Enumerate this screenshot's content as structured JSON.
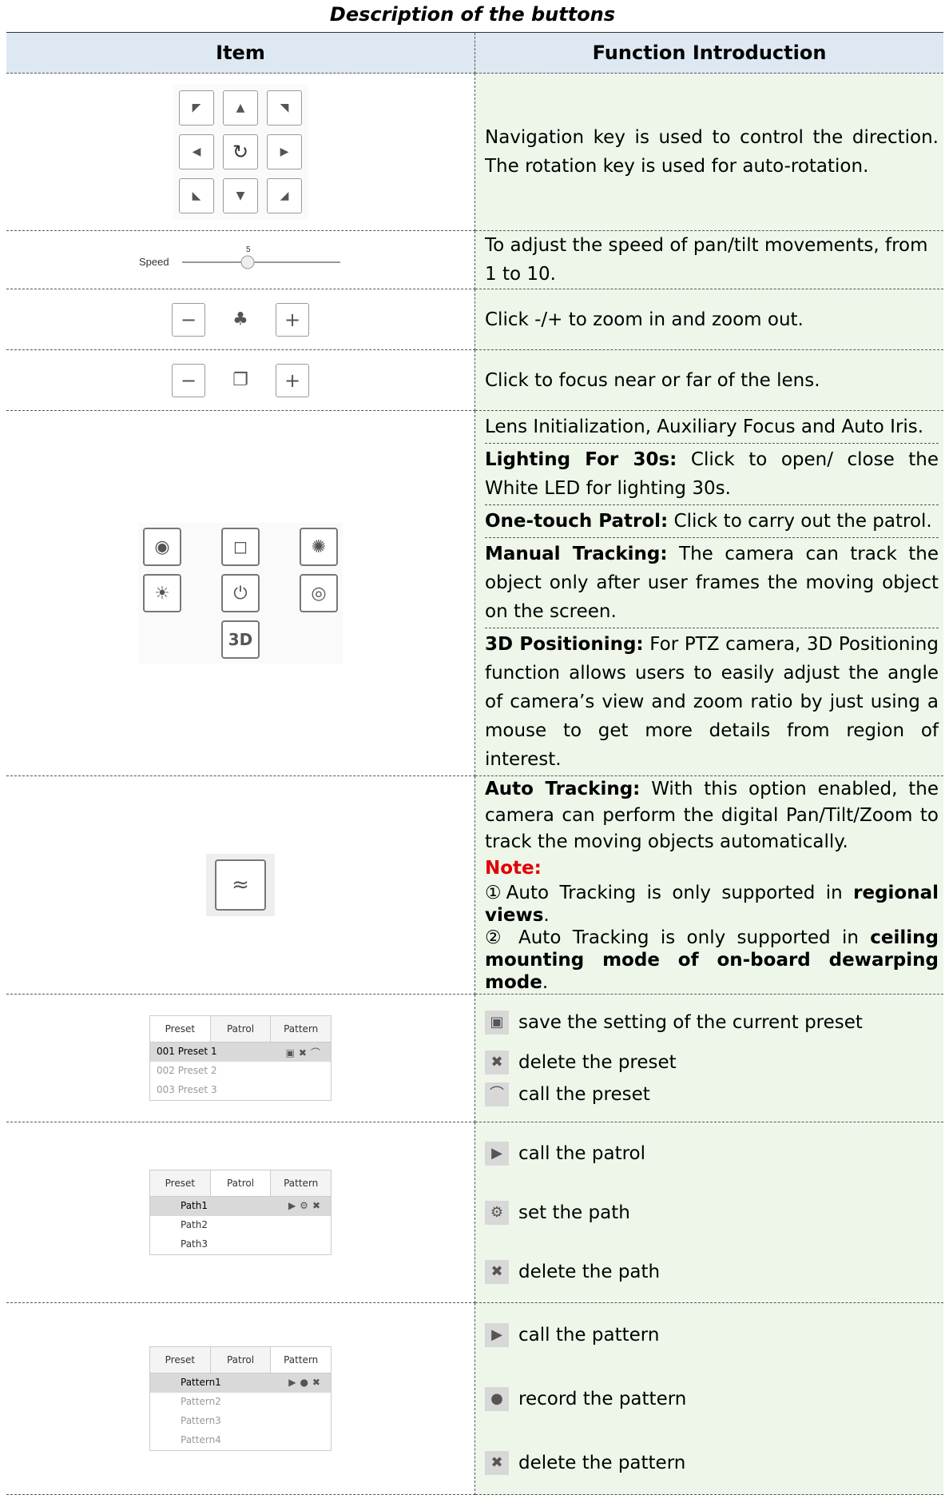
{
  "title": "Description of the buttons",
  "header": {
    "item": "Item",
    "function": "Function Introduction"
  },
  "rows": {
    "nav": {
      "text": "Navigation key is used to control the direction. The rotation key is used for auto-rotation."
    },
    "speed": {
      "label": "Speed",
      "value": "5",
      "text": "To adjust the speed of pan/tilt movements, from 1 to 10."
    },
    "zoom": {
      "text": "Click -/+ to zoom in and zoom out."
    },
    "focus": {
      "text": "Click to focus near or far of the lens."
    },
    "group": {
      "line1": "Lens Initialization, Auxiliary Focus and Auto Iris.",
      "lighting_bold": "Lighting For 30s:",
      "lighting_text": " Click to open/ close the White LED for lighting 30s.",
      "patrol_bold": "One-touch Patrol:",
      "patrol_text": " Click to carry out the patrol.",
      "manual_bold": "Manual Tracking:",
      "manual_text": " The camera can track the object only after user frames the moving object on the screen.",
      "pos_bold": "3D Positioning:",
      "pos_text": " For PTZ camera, 3D Positioning function allows users to easily adjust the angle of camera’s view and zoom ratio by just using a mouse to get more details from region of interest.",
      "icon3d": "3D"
    },
    "auto": {
      "bold": "Auto Tracking:",
      "text": " With this option enabled, the camera can perform the digital Pan/Tilt/Zoom to track the moving objects automatically.",
      "note": "Note:",
      "n1a": "①Auto Tracking is only supported in ",
      "n1b": "regional views",
      "n1c": ".",
      "n2a": "② Auto Tracking is only supported in ",
      "n2b": "ceiling mounting mode of on-board dewarping mode",
      "n2c": "."
    },
    "preset": {
      "tabs": [
        "Preset",
        "Patrol",
        "Pattern"
      ],
      "items": [
        "001 Preset 1",
        "002 Preset 2",
        "003 Preset 3"
      ],
      "save": "save the setting of the current preset",
      "delete": "delete the preset",
      "call": "call the preset"
    },
    "patrol": {
      "tabs": [
        "Preset",
        "Patrol",
        "Pattern"
      ],
      "items": [
        "Path1",
        "Path2",
        "Path3"
      ],
      "call": "call the patrol",
      "set": "set the path",
      "delete": "delete the path"
    },
    "pattern": {
      "tabs": [
        "Preset",
        "Patrol",
        "Pattern"
      ],
      "items": [
        "Pattern1",
        "Pattern2",
        "Pattern3",
        "Pattern4"
      ],
      "call": "call the pattern",
      "record": "record the pattern",
      "delete": "delete the pattern"
    }
  }
}
